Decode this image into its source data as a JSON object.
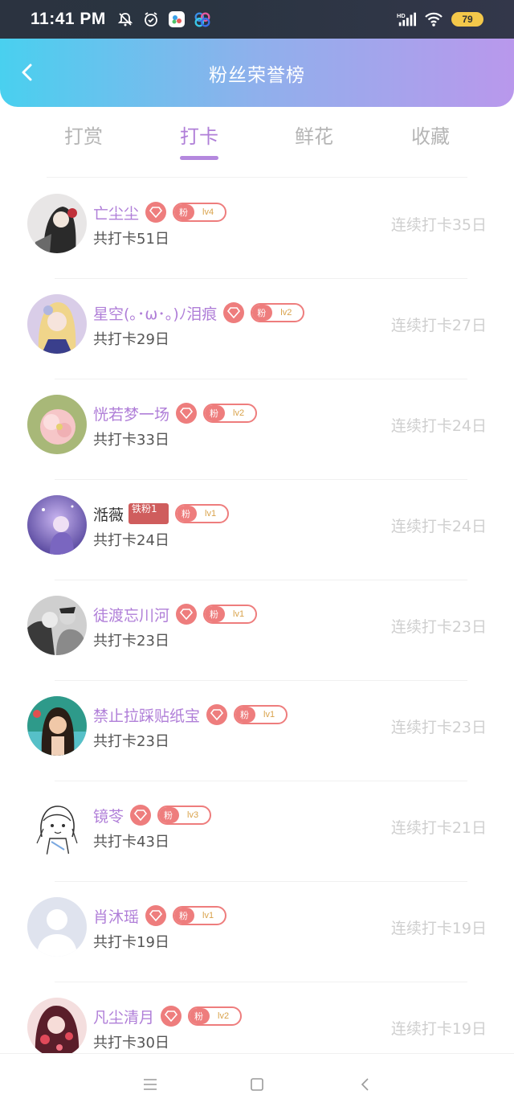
{
  "status_bar": {
    "time": "11:41 PM",
    "battery": "79",
    "icons": [
      "silent-bell-icon",
      "alarm-icon",
      "app-icon",
      "cloud-icon",
      "hd-signal-icon",
      "wifi-icon"
    ]
  },
  "header": {
    "title": "粉丝荣誉榜"
  },
  "tabs": [
    {
      "label": "打赏",
      "active": false
    },
    {
      "label": "打卡",
      "active": true
    },
    {
      "label": "鲜花",
      "active": false
    },
    {
      "label": "收藏",
      "active": false
    }
  ],
  "colors": {
    "accent": "#b07fd8",
    "header_gradient_start": "#49d0ef",
    "header_gradient_end": "#b998ec",
    "badge_red": "#ee7d7d",
    "level_text": "#d9a24a"
  },
  "fans": [
    {
      "name": "亡尘尘",
      "gem": true,
      "fan_tag": "粉",
      "level": "lv4",
      "total": "共打卡51日",
      "streak": "连续打卡35日",
      "name_color": "accent",
      "avatar": "dark-anime"
    },
    {
      "name": "星空(｡･ω･｡)ﾉ泪痕",
      "gem": true,
      "fan_tag": "粉",
      "level": "lv2",
      "total": "共打卡29日",
      "streak": "连续打卡27日",
      "name_color": "accent",
      "avatar": "blonde-anime"
    },
    {
      "name": "恍若梦一场",
      "gem": true,
      "fan_tag": "粉",
      "level": "lv2",
      "total": "共打卡33日",
      "streak": "连续打卡24日",
      "name_color": "accent",
      "avatar": "flower"
    },
    {
      "name": "湉薇",
      "iron_badge": "铁粉1",
      "gem": false,
      "fan_tag": "粉",
      "level": "lv1",
      "total": "共打卡24日",
      "streak": "连续打卡24日",
      "name_color": "dark",
      "avatar": "purple-girl"
    },
    {
      "name": "徒渡忘川河",
      "gem": true,
      "fan_tag": "粉",
      "level": "lv1",
      "total": "共打卡23日",
      "streak": "连续打卡23日",
      "name_color": "accent",
      "avatar": "bw-couple"
    },
    {
      "name": "禁止拉踩贴纸宝",
      "gem": true,
      "fan_tag": "粉",
      "level": "lv1",
      "total": "共打卡23日",
      "streak": "连续打卡23日",
      "name_color": "accent",
      "avatar": "green-girl"
    },
    {
      "name": "镜苓",
      "gem": true,
      "fan_tag": "粉",
      "level": "lv3",
      "total": "共打卡43日",
      "streak": "连续打卡21日",
      "name_color": "accent",
      "avatar": "sketch"
    },
    {
      "name": "肖沐瑶",
      "gem": true,
      "fan_tag": "粉",
      "level": "lv1",
      "total": "共打卡19日",
      "streak": "连续打卡19日",
      "name_color": "accent",
      "avatar": "default"
    },
    {
      "name": "凡尘清月",
      "gem": true,
      "fan_tag": "粉",
      "level": "lv2",
      "total": "共打卡30日",
      "streak": "连续打卡19日",
      "name_color": "accent",
      "avatar": "red-anime"
    }
  ],
  "nav_bar": {
    "icons": [
      "menu-icon",
      "home-square-icon",
      "back-triangle-icon"
    ]
  }
}
